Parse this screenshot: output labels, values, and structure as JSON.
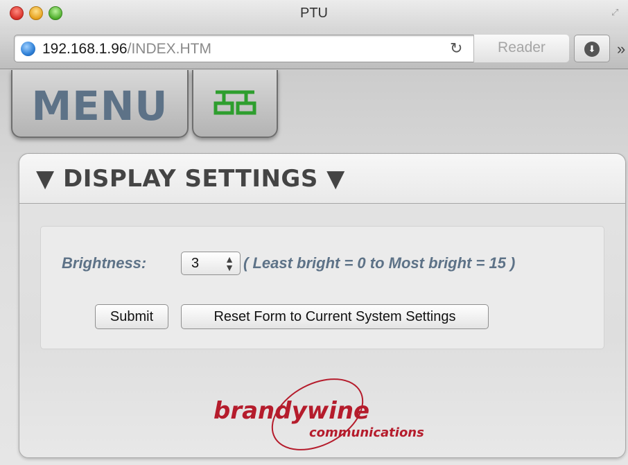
{
  "window": {
    "title": "PTU"
  },
  "address_bar": {
    "host": "192.168.1.96",
    "path": "/INDEX.HTM",
    "reader_label": "Reader"
  },
  "nav": {
    "menu_label": "MENU",
    "network_icon": "network-icon",
    "accent_color": "#2e9e2e"
  },
  "panel": {
    "title": "▼ DISPLAY SETTINGS ▼"
  },
  "form": {
    "brightness_label": "Brightness:",
    "brightness_value": "3",
    "range_note": "( Least bright = 0 to Most bright = 15 )",
    "submit_label": "Submit",
    "reset_label": "Reset Form to Current System Settings"
  },
  "logo": {
    "brand": "brandywine",
    "tagline": "communications",
    "color": "#b51c2c"
  }
}
